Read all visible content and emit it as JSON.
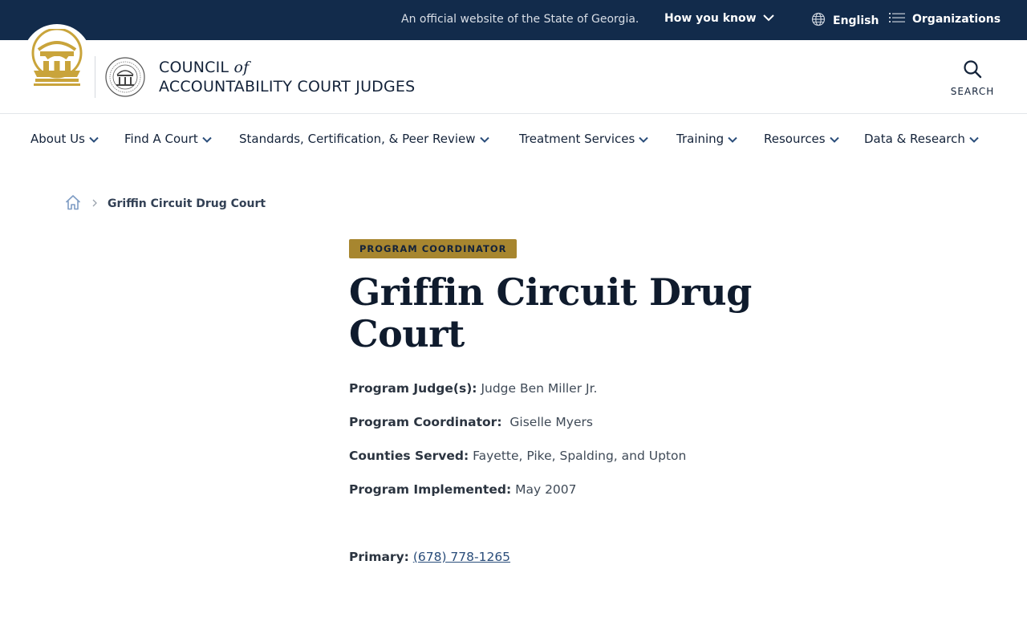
{
  "gov_banner": {
    "official_text": "An official website of the State of Georgia.",
    "how_you_know": "How you know",
    "language": "English",
    "organizations": "Organizations"
  },
  "header": {
    "site_name_line1_a": "COUNCIL ",
    "site_name_line1_b": "of",
    "site_name_line2": "ACCOUNTABILITY COURT JUDGES",
    "search_label": "SEARCH"
  },
  "nav": {
    "items": [
      {
        "label": "About Us"
      },
      {
        "label": "Find A Court"
      },
      {
        "label": "Standards, Certification, & Peer Review"
      },
      {
        "label": "Treatment Services"
      },
      {
        "label": "Training"
      },
      {
        "label": "Resources"
      },
      {
        "label": "Data & Research"
      }
    ]
  },
  "breadcrumb": {
    "current": "Griffin Circuit Drug Court"
  },
  "main": {
    "badge": "PROGRAM COORDINATOR",
    "title": "Griffin Circuit Drug Court",
    "judge_label": "Program Judge(s):",
    "judge_value": "Judge Ben Miller Jr.",
    "coordinator_label": "Program Coordinator:",
    "coordinator_value": "Giselle Myers",
    "counties_label": "Counties Served:",
    "counties_value": "Fayette, Pike, Spalding, and Upton",
    "implemented_label": "Program Implemented:",
    "implemented_value": "May 2007",
    "phone_label": "Primary:",
    "phone_value": "(678) 778-1265"
  },
  "colors": {
    "banner_bg": "#122b4b",
    "accent_gold": "#a7862f",
    "nav_chevron": "#2a4d7a"
  }
}
